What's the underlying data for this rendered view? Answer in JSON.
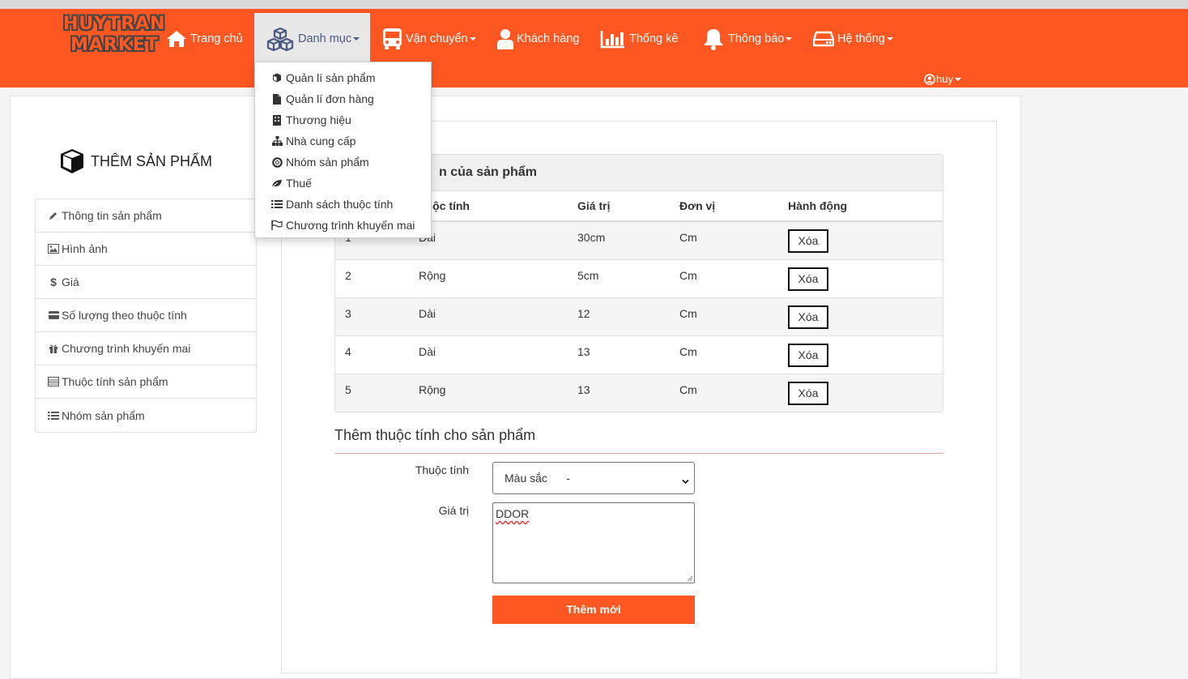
{
  "brand": {
    "line1": "HUYTRAN",
    "line2": "MARKET"
  },
  "nav": {
    "home": "Trang chủ",
    "catalog": "Danh mục",
    "shipping": "Vận chuyển",
    "customers": "Khách hàng",
    "stats": "Thống kê",
    "notifications": "Thông báo",
    "system": "Hệ thống"
  },
  "user": {
    "name": "huy"
  },
  "dropdown": {
    "items": [
      {
        "label": "Quản lí sản phẩm",
        "icon": "cube-icon"
      },
      {
        "label": "Quản lí đơn hàng",
        "icon": "file-icon"
      },
      {
        "label": "Thương hiệu",
        "icon": "building-icon"
      },
      {
        "label": "Nhà cung cấp",
        "icon": "sitemap-icon"
      },
      {
        "label": "Nhóm sản phẩm",
        "icon": "lifering-icon"
      },
      {
        "label": "Thuế",
        "icon": "leaf-icon"
      },
      {
        "label": "Danh sách thuộc tính",
        "icon": "list-icon"
      },
      {
        "label": "Chương trình khuyến mai",
        "icon": "flag-icon"
      }
    ]
  },
  "page": {
    "title": "THÊM SẢN PHẨM"
  },
  "sidebar": {
    "items": [
      {
        "label": "Thông tin sản phẩm",
        "icon": "pencil-icon"
      },
      {
        "label": "Hình ảnh",
        "icon": "image-icon"
      },
      {
        "label": "Giá",
        "icon": "dollar-icon"
      },
      {
        "label": "Số lượng theo thuộc tính",
        "icon": "card-icon"
      },
      {
        "label": "Chương trình khuyến mai",
        "icon": "gift-icon"
      },
      {
        "label": "Thuộc tính sản phẩm",
        "icon": "table-icon"
      },
      {
        "label": "Nhóm sản phẩm",
        "icon": "list-icon"
      }
    ]
  },
  "attrs": {
    "heading": "n của sản phẩm",
    "columns": [
      "",
      "huộc tính",
      "Giá trị",
      "Đơn vị",
      "Hành động"
    ],
    "rows": [
      {
        "no": "1",
        "attr": "Dài",
        "value": "30cm",
        "unit": "Cm",
        "action": "Xóa"
      },
      {
        "no": "2",
        "attr": "Rộng",
        "value": "5cm",
        "unit": "Cm",
        "action": "Xóa"
      },
      {
        "no": "3",
        "attr": "Dài",
        "value": "12",
        "unit": "Cm",
        "action": "Xóa"
      },
      {
        "no": "4",
        "attr": "Dài",
        "value": "13",
        "unit": "Cm",
        "action": "Xóa"
      },
      {
        "no": "5",
        "attr": "Rộng",
        "value": "13",
        "unit": "Cm",
        "action": "Xóa"
      }
    ]
  },
  "form": {
    "title": "Thêm thuộc tính cho sản phẩm",
    "attr_label": "Thuộc tính",
    "attr_selected": "Màu sắc      -",
    "value_label": "Giá trị",
    "value_text": "DDOR",
    "submit": "Thêm mới"
  },
  "colors": {
    "accent": "#ff5722"
  }
}
